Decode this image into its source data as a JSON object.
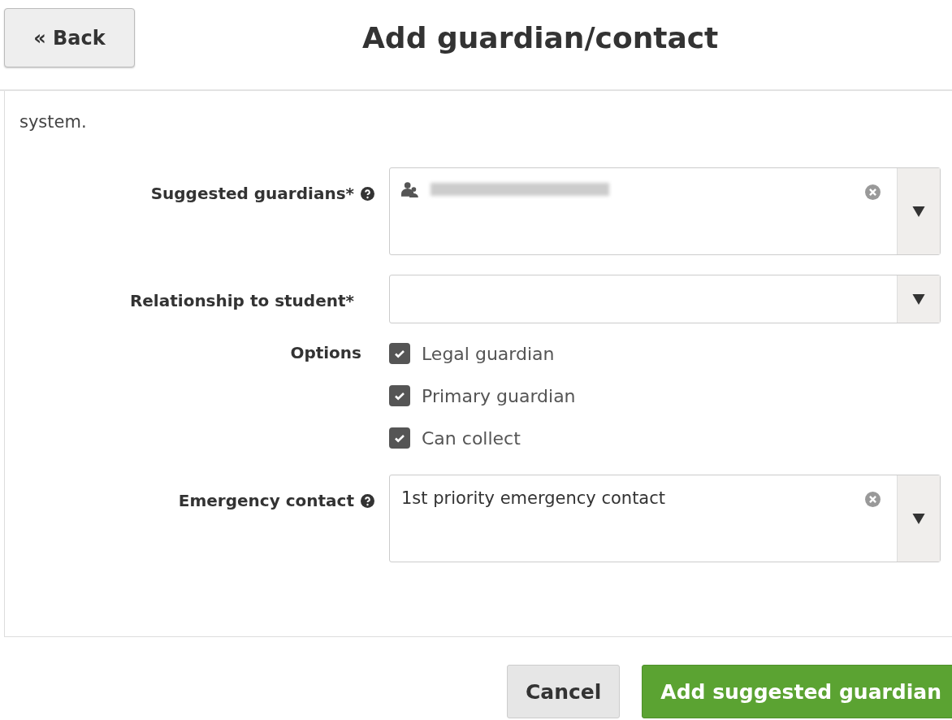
{
  "back_button": "« Back",
  "title": "Add guardian/contact",
  "intro": "system.",
  "fields": [
    {
      "kind": "person-select",
      "label": "Suggested guardians*",
      "help": true,
      "clearable": true,
      "tall": true
    },
    {
      "kind": "select",
      "label": "Relationship to student*",
      "help": false,
      "clearable": false,
      "tall": false
    },
    {
      "kind": "checkboxes",
      "label": "Options",
      "options": [
        {
          "label": "Legal guardian",
          "checked": true
        },
        {
          "label": "Primary guardian",
          "checked": true
        },
        {
          "label": "Can collect",
          "checked": true
        }
      ]
    },
    {
      "kind": "select",
      "label": "Emergency contact",
      "help": true,
      "clearable": true,
      "tall": true,
      "value": "1st priority emergency contact"
    }
  ],
  "buttons": [
    {
      "label": "Cancel",
      "kind": "secondary"
    },
    {
      "label": "Add suggested guardian",
      "kind": "primary"
    }
  ]
}
